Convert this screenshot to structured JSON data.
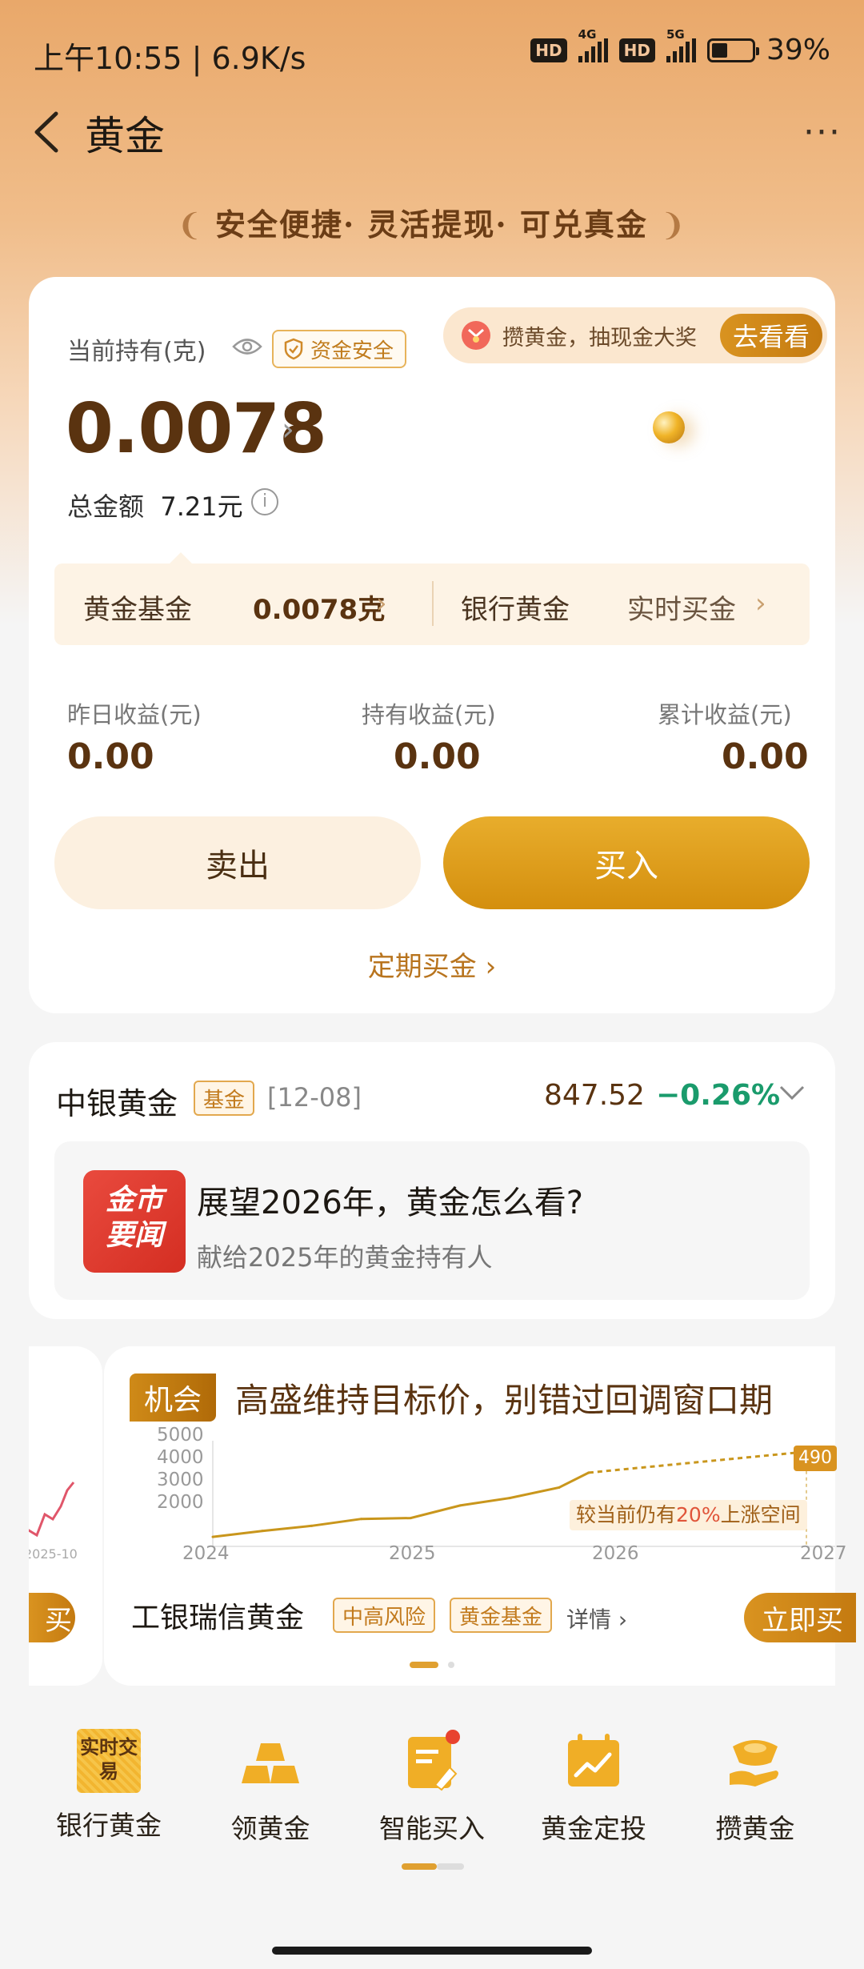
{
  "status_bar": {
    "time": "上午10:55 | 6.9K/s",
    "net1": "4G",
    "net2": "5G",
    "hd": "HD",
    "battery": "39%"
  },
  "header": {
    "title": "黄金",
    "more": "···"
  },
  "slogan": {
    "items": [
      "安全便捷",
      "灵活提现",
      "可兑真金"
    ],
    "sep": "·"
  },
  "holding": {
    "label": "当前持有(克)",
    "safe_badge": "资金安全",
    "promo_text": "攒黄金，抽现金大奖",
    "promo_button": "去看看",
    "amount": "0.0078",
    "total_label": "总金额",
    "total_value": "7.21元",
    "fund_label": "黄金基金",
    "fund_value": "0.0078克",
    "bank_label": "银行黄金",
    "bank_action": "实时买金",
    "stats": [
      {
        "label": "昨日收益(元)",
        "value": "0.00"
      },
      {
        "label": "持有收益(元)",
        "value": "0.00"
      },
      {
        "label": "累计收益(元)",
        "value": "0.00"
      }
    ],
    "sell_label": "卖出",
    "buy_label": "买入",
    "regular_label": "定期买金"
  },
  "market": {
    "name": "中银黄金",
    "tag": "基金",
    "date": "[12-08]",
    "price": "847.52",
    "change": "−0.26%",
    "news_logo_line1": "金市",
    "news_logo_line2": "要闻",
    "news_title": "展望2026年，黄金怎么看?",
    "news_sub": "献给2025年的黄金持有人"
  },
  "carousel": {
    "tag": "机会",
    "title": "高盛维持目标价，别错过回调窗口期",
    "note": "较当前仍有",
    "note_pct": "20%",
    "note_tail": "上涨空间",
    "target_label": "490",
    "fund_name": "工银瑞信黄金",
    "risk_tag": "中高风险",
    "type_tag": "黄金基金",
    "detail": "详情",
    "buy_label": "立即买",
    "peek_buy": "买入",
    "peek_axis": "2025-10"
  },
  "chart_data": {
    "type": "line",
    "y_ticks": [
      "5000",
      "4000",
      "3000",
      "2000"
    ],
    "x_ticks": [
      "2024",
      "2025",
      "2026",
      "2027"
    ],
    "ylim": [
      2000,
      5000
    ],
    "series": [
      {
        "x": [
          2024.0,
          2024.25,
          2024.5,
          2024.75,
          2025.0,
          2025.25,
          2025.5,
          2025.75,
          2025.9
        ],
        "values": [
          2050,
          2250,
          2420,
          2650,
          2680,
          3100,
          3350,
          3700,
          4200
        ]
      },
      {
        "x": [
          2025.9,
          2027.0
        ],
        "values": [
          4200,
          4900
        ]
      }
    ]
  },
  "nav": [
    {
      "label": "银行黄金",
      "icon": "realtime-trade-icon",
      "icon_text": "实时交易"
    },
    {
      "label": "领黄金",
      "icon": "gold-bars-icon"
    },
    {
      "label": "智能买入",
      "icon": "smart-buy-icon"
    },
    {
      "label": "黄金定投",
      "icon": "calendar-chart-icon"
    },
    {
      "label": "攒黄金",
      "icon": "gold-ingot-hand-icon"
    }
  ]
}
